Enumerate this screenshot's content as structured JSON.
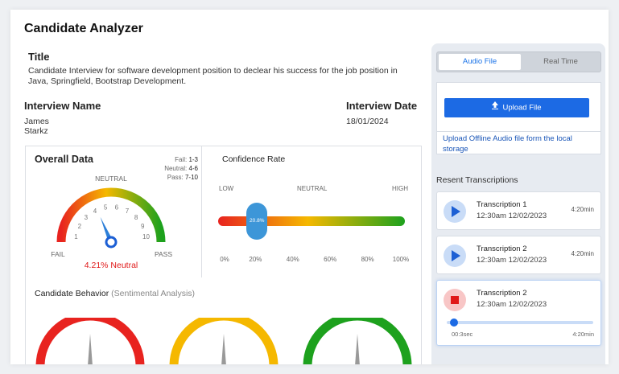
{
  "app": {
    "title": "Candidate Analyzer"
  },
  "title_section": {
    "heading": "Title",
    "text": "Candidate Interview for software development position to declear his success for the job position in Java, Springfield, Bootstrap Development."
  },
  "interview": {
    "name_heading": "Interview Name",
    "name_line1": "James",
    "name_line2": "Starkz",
    "date_heading": "Interview Date",
    "date": "18/01/2024"
  },
  "overall": {
    "title": "Overall Data",
    "legend_fail": "Fail: ",
    "legend_fail_range": "1-3",
    "legend_neutral": "Neutral: ",
    "legend_neutral_range": "4-6",
    "legend_pass": "Pass: ",
    "legend_pass_range": "7-10",
    "top_label": "NEUTRAL",
    "fail_label": "FAIL",
    "pass_label": "PASS",
    "ticks": [
      "1",
      "2",
      "3",
      "4",
      "5",
      "6",
      "7",
      "8",
      "9",
      "10"
    ],
    "value": 4.21,
    "result": "4.21% Neutral"
  },
  "confidence": {
    "title": "Confidence Rate",
    "low": "LOW",
    "neutral": "NEUTRAL",
    "high": "HIGH",
    "value_label": "20.8%",
    "value": 20.8,
    "ticks": [
      "0%",
      "20%",
      "40%",
      "60%",
      "80%",
      "100%"
    ]
  },
  "behavior": {
    "title": "Candidate Behavior",
    "subtitle": "(Sentimental Analysis)"
  },
  "right": {
    "tab_audio": "Audio File",
    "tab_realtime": "Real Time",
    "upload_label": "Upload File",
    "upload_hint": "Upload Offline Audio file form the local storage",
    "recent_heading": "Resent Transcriptions",
    "transcriptions": [
      {
        "name": "Transcription 1",
        "time": "12:30am 12/02/2023",
        "duration": "4:20min"
      },
      {
        "name": "Transcription 2",
        "time": "12:30am 12/02/2023",
        "duration": "4:20min"
      },
      {
        "name": "Transcription 2",
        "time": "12:30am 12/02/2023",
        "elapsed": "00:3sec",
        "total": "4:20min",
        "progress": 0.02
      }
    ]
  },
  "colors": {
    "accent": "#1c6ae4",
    "fail": "#e8231f",
    "neutral": "#f5b800",
    "pass": "#1da11d"
  }
}
